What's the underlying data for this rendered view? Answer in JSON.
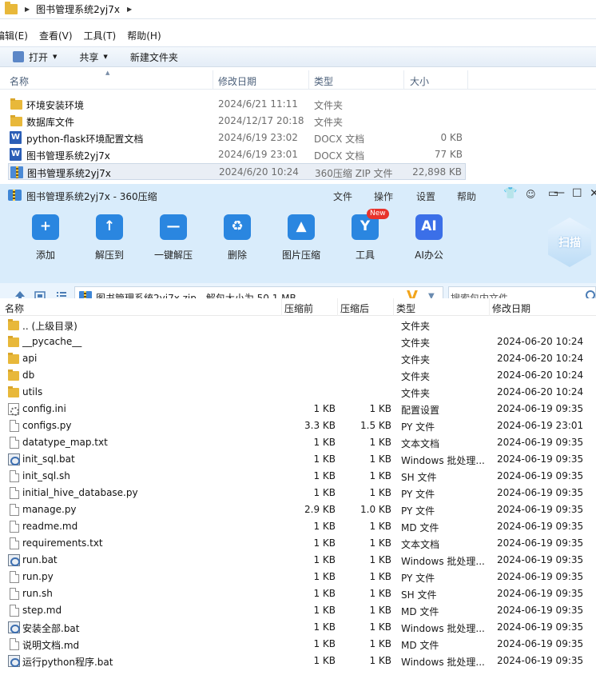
{
  "explorer": {
    "address_crumb": "图书管理系统2yj7x",
    "menu": [
      "编辑(E)",
      "查看(V)",
      "工具(T)",
      "帮助(H)"
    ],
    "commands": [
      {
        "label": "打开",
        "has_dropdown": true
      },
      {
        "label": "共享",
        "has_dropdown": true
      },
      {
        "label": "新建文件夹",
        "has_dropdown": false
      }
    ],
    "columns": {
      "name": "名称",
      "date": "修改日期",
      "type": "类型",
      "size": "大小"
    },
    "files": [
      {
        "name": "环境安装环境",
        "date": "2024/6/21 11:11",
        "type": "文件夹",
        "size": "",
        "icon": "folder-icon",
        "selected": false
      },
      {
        "name": "数据库文件",
        "date": "2024/12/17 20:18",
        "type": "文件夹",
        "size": "",
        "icon": "folder-icon",
        "selected": false
      },
      {
        "name": "python-flask环境配置文档",
        "date": "2024/6/19 23:02",
        "type": "DOCX 文档",
        "size": "0 KB",
        "icon": "word-doc-icon",
        "selected": false
      },
      {
        "name": "图书管理系统2yj7x",
        "date": "2024/6/19 23:01",
        "type": "DOCX 文档",
        "size": "77 KB",
        "icon": "word-doc-icon",
        "selected": false
      },
      {
        "name": "图书管理系统2yj7x",
        "date": "2024/6/20 10:24",
        "type": "360压缩 ZIP 文件",
        "size": "22,898 KB",
        "icon": "zip-archive-icon",
        "selected": true
      }
    ]
  },
  "zip": {
    "title": "图书管理系统2yj7x - 360压缩",
    "menu": [
      "文件",
      "操作",
      "设置",
      "帮助"
    ],
    "window_controls": [
      "shirt-icon",
      "feedback-icon",
      "menu-icon",
      "minimize-icon",
      "maximize-icon",
      "close-icon"
    ],
    "toolbar": [
      {
        "label": "添加",
        "icon": "add-icon",
        "color": "#2a86e0"
      },
      {
        "label": "解压到",
        "icon": "extract-to-icon",
        "color": "#2a86e0"
      },
      {
        "label": "一键解压",
        "icon": "one-click-extract-icon",
        "color": "#2a86e0"
      },
      {
        "label": "删除",
        "icon": "trash-icon",
        "color": "#2a86e0"
      },
      {
        "label": "图片压缩",
        "icon": "image-compress-icon",
        "color": "#2a86e0"
      },
      {
        "label": "工具",
        "icon": "tools-icon",
        "color": "#2a86e0"
      },
      {
        "label": "AI办公",
        "icon": "ai-office-icon",
        "color": "#3b6fe8"
      }
    ],
    "new_badge": "New",
    "scan_label": "扫描",
    "path_text": "图书管理系统2yj7x.zip - 解包大小为 50.1 MB",
    "search_placeholder": "搜索包内文件",
    "columns": {
      "name": "名称",
      "compressed_before": "压缩前",
      "compressed_after": "压缩后",
      "type": "类型",
      "date": "修改日期"
    },
    "rows": [
      {
        "name": ".. (上级目录)",
        "before": "",
        "after": "",
        "type": "文件夹",
        "date": "",
        "icon": "folder"
      },
      {
        "name": "__pycache__",
        "before": "",
        "after": "",
        "type": "文件夹",
        "date": "2024-06-20 10:24",
        "icon": "folder"
      },
      {
        "name": "api",
        "before": "",
        "after": "",
        "type": "文件夹",
        "date": "2024-06-20 10:24",
        "icon": "folder"
      },
      {
        "name": "db",
        "before": "",
        "after": "",
        "type": "文件夹",
        "date": "2024-06-20 10:24",
        "icon": "folder"
      },
      {
        "name": "utils",
        "before": "",
        "after": "",
        "type": "文件夹",
        "date": "2024-06-20 10:24",
        "icon": "folder"
      },
      {
        "name": "config.ini",
        "before": "1 KB",
        "after": "1 KB",
        "type": "配置设置",
        "date": "2024-06-19 09:35",
        "icon": "gear"
      },
      {
        "name": "configs.py",
        "before": "3.3 KB",
        "after": "1.5 KB",
        "type": "PY 文件",
        "date": "2024-06-19 23:01",
        "icon": "doc"
      },
      {
        "name": "datatype_map.txt",
        "before": "1 KB",
        "after": "1 KB",
        "type": "文本文档",
        "date": "2024-06-19 09:35",
        "icon": "doc"
      },
      {
        "name": "init_sql.bat",
        "before": "1 KB",
        "after": "1 KB",
        "type": "Windows 批处理...",
        "date": "2024-06-19 09:35",
        "icon": "bat"
      },
      {
        "name": "init_sql.sh",
        "before": "1 KB",
        "after": "1 KB",
        "type": "SH 文件",
        "date": "2024-06-19 09:35",
        "icon": "doc"
      },
      {
        "name": "initial_hive_database.py",
        "before": "1 KB",
        "after": "1 KB",
        "type": "PY 文件",
        "date": "2024-06-19 09:35",
        "icon": "doc"
      },
      {
        "name": "manage.py",
        "before": "2.9 KB",
        "after": "1.0 KB",
        "type": "PY 文件",
        "date": "2024-06-19 09:35",
        "icon": "doc"
      },
      {
        "name": "readme.md",
        "before": "1 KB",
        "after": "1 KB",
        "type": "MD 文件",
        "date": "2024-06-19 09:35",
        "icon": "doc"
      },
      {
        "name": "requirements.txt",
        "before": "1 KB",
        "after": "1 KB",
        "type": "文本文档",
        "date": "2024-06-19 09:35",
        "icon": "doc"
      },
      {
        "name": "run.bat",
        "before": "1 KB",
        "after": "1 KB",
        "type": "Windows 批处理...",
        "date": "2024-06-19 09:35",
        "icon": "bat"
      },
      {
        "name": "run.py",
        "before": "1 KB",
        "after": "1 KB",
        "type": "PY 文件",
        "date": "2024-06-19 09:35",
        "icon": "doc"
      },
      {
        "name": "run.sh",
        "before": "1 KB",
        "after": "1 KB",
        "type": "SH 文件",
        "date": "2024-06-19 09:35",
        "icon": "doc"
      },
      {
        "name": "step.md",
        "before": "1 KB",
        "after": "1 KB",
        "type": "MD 文件",
        "date": "2024-06-19 09:35",
        "icon": "doc"
      },
      {
        "name": "安装全部.bat",
        "before": "1 KB",
        "after": "1 KB",
        "type": "Windows 批处理...",
        "date": "2024-06-19 09:35",
        "icon": "bat"
      },
      {
        "name": "说明文档.md",
        "before": "1 KB",
        "after": "1 KB",
        "type": "MD 文件",
        "date": "2024-06-19 09:35",
        "icon": "doc"
      },
      {
        "name": "运行python程序.bat",
        "before": "1 KB",
        "after": "1 KB",
        "type": "Windows 批处理...",
        "date": "2024-06-19 09:35",
        "icon": "bat"
      }
    ]
  }
}
